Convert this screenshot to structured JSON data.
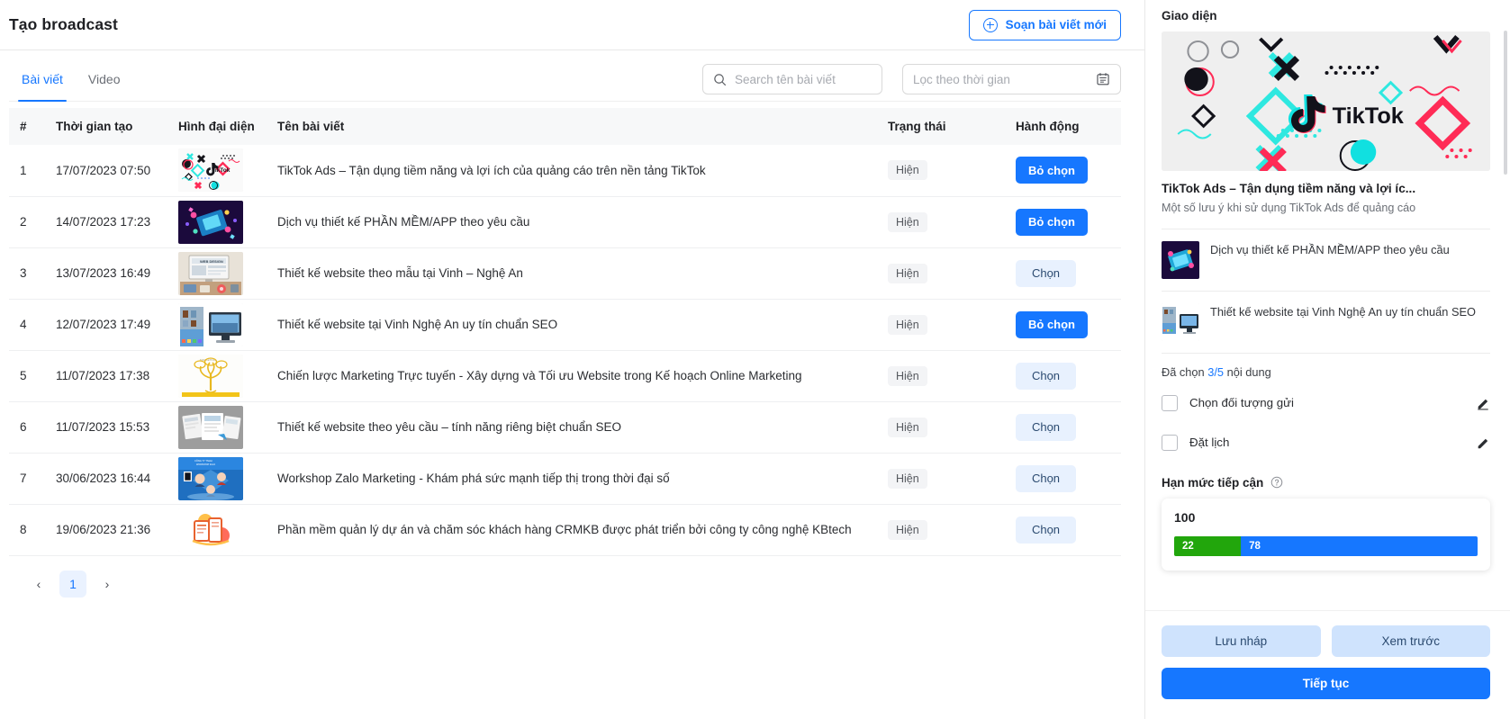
{
  "header": {
    "title": "Tạo broadcast",
    "compose_button": "Soạn bài viết mới"
  },
  "tabs": [
    {
      "label": "Bài viết",
      "active": true
    },
    {
      "label": "Video",
      "active": false
    }
  ],
  "search": {
    "placeholder": "Search tên bài viết",
    "value": ""
  },
  "daterange": {
    "placeholder": "Lọc theo thời gian",
    "value": ""
  },
  "table": {
    "columns": [
      "#",
      "Thời gian tạo",
      "Hình đại diện",
      "Tên bài viết",
      "Trạng thái",
      "Hành động"
    ],
    "rows": [
      {
        "idx": "1",
        "time": "17/07/2023 07:50",
        "name": "TikTok Ads – Tận dụng tiềm năng và lợi ích của quảng cáo trên nền tảng TikTok",
        "status": "Hiện",
        "action": "Bỏ chọn",
        "selected": true,
        "thumb": "tiktok"
      },
      {
        "idx": "2",
        "time": "14/07/2023 17:23",
        "name": "Dịch vụ thiết kế PHẦN MỀM/APP theo yêu cầu",
        "status": "Hiện",
        "action": "Bỏ chọn",
        "selected": true,
        "thumb": "app"
      },
      {
        "idx": "3",
        "time": "13/07/2023 16:49",
        "name": "Thiết kế website theo mẫu tại Vinh – Nghệ An",
        "status": "Hiện",
        "action": "Chọn",
        "selected": false,
        "thumb": "webdesign"
      },
      {
        "idx": "4",
        "time": "12/07/2023 17:49",
        "name": "Thiết kế website tại Vinh Nghệ An uy tín chuẩn SEO",
        "status": "Hiện",
        "action": "Bỏ chọn",
        "selected": true,
        "thumb": "vinh"
      },
      {
        "idx": "5",
        "time": "11/07/2023 17:38",
        "name": "Chiến lược Marketing Trực tuyến - Xây dựng và Tối ưu Website trong Kế hoạch Online Marketing",
        "status": "Hiện",
        "action": "Chọn",
        "selected": false,
        "thumb": "tree"
      },
      {
        "idx": "6",
        "time": "11/07/2023 15:53",
        "name": "Thiết kế website theo yêu cầu – tính năng riêng biệt chuẩn SEO",
        "status": "Hiện",
        "action": "Chọn",
        "selected": false,
        "thumb": "screens"
      },
      {
        "idx": "7",
        "time": "30/06/2023 16:44",
        "name": "Workshop Zalo Marketing - Khám phá sức mạnh tiếp thị trong thời đại số",
        "status": "Hiện",
        "action": "Chọn",
        "selected": false,
        "thumb": "workshop"
      },
      {
        "idx": "8",
        "time": "19/06/2023 21:36",
        "name": "Phần mềm quản lý dự án và chăm sóc khách hàng CRMKB được phát triển bởi công ty công nghệ KBtech",
        "status": "Hiện",
        "action": "Chọn",
        "selected": false,
        "thumb": "crm"
      }
    ]
  },
  "pagination": {
    "prev": "‹",
    "pages": [
      "1"
    ],
    "next": "›",
    "current": "1"
  },
  "sidebar": {
    "title": "Giao diện",
    "hero": {
      "brand": "TikTok",
      "title": "TikTok Ads – Tận dụng tiềm năng và lợi íc...",
      "subtitle": "Một số lưu ý khi sử dụng TikTok Ads để quảng cáo"
    },
    "items": [
      {
        "text": "Dịch vụ thiết kế PHẦN MỀM/APP theo yêu cầu",
        "thumb": "app"
      },
      {
        "text": "Thiết kế website tại Vinh Nghệ An uy tín chuẩn SEO",
        "thumb": "vinh"
      }
    ],
    "chosen_prefix": "Đã chọn ",
    "chosen_count": "3/5",
    "chosen_suffix": " nội dung",
    "options": [
      {
        "label": "Chọn đối tượng gửi",
        "checked": false
      },
      {
        "label": "Đặt lịch",
        "checked": false
      }
    ],
    "limit": {
      "title": "Hạn mức tiếp cận",
      "total": "100",
      "segments": [
        {
          "label": "22",
          "value": 22,
          "color": "#22a60c"
        },
        {
          "label": "78",
          "value": 78,
          "color": "#1677ff"
        }
      ]
    },
    "footer": {
      "draft": "Lưu nháp",
      "preview": "Xem trước",
      "continue": "Tiếp tục"
    }
  },
  "colors": {
    "accent": "#1677ff",
    "green": "#22a60c",
    "ghost_bg": "#e8f1fe"
  }
}
